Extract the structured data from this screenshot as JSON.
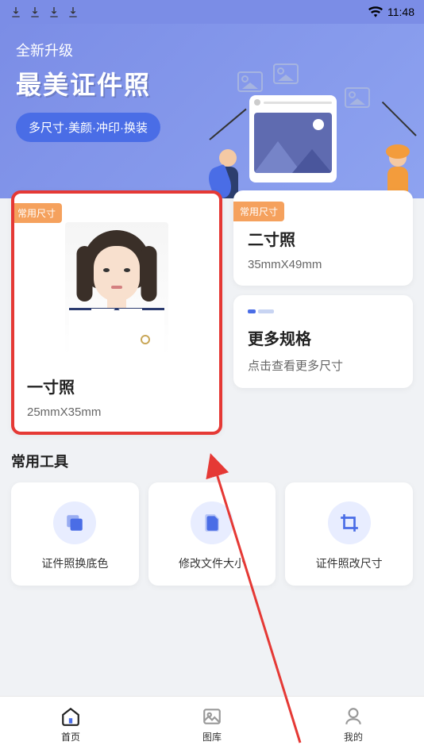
{
  "status": {
    "time": "11:48"
  },
  "header": {
    "subtitle": "全新升级",
    "title": "最美证件照",
    "pill": "多尺寸·美颜·冲印·换装"
  },
  "cards": {
    "badge_label": "常用尺寸",
    "one_inch": {
      "title": "一寸照",
      "size": "25mmX35mm"
    },
    "two_inch": {
      "title": "二寸照",
      "size": "35mmX49mm"
    },
    "more": {
      "title": "更多规格",
      "sub": "点击查看更多尺寸"
    }
  },
  "tools": {
    "section_title": "常用工具",
    "items": [
      {
        "label": "证件照换底色"
      },
      {
        "label": "修改文件大小"
      },
      {
        "label": "证件照改尺寸"
      }
    ]
  },
  "nav": {
    "home": "首页",
    "gallery": "图库",
    "mine": "我的"
  },
  "annotation": {
    "highlight_color": "#e53935"
  }
}
